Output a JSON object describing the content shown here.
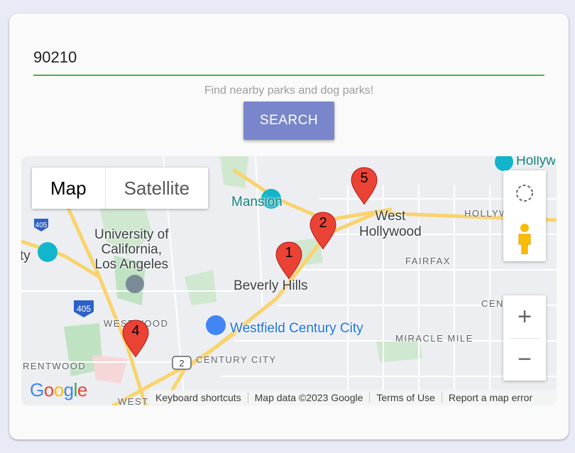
{
  "search": {
    "value": "90210",
    "hint": "Find nearby parks and dog parks!",
    "button_label": "SEARCH"
  },
  "map": {
    "type_buttons": {
      "map": "Map",
      "satellite": "Satellite"
    },
    "labels": {
      "ucla": "University of\nCalifornia,\nLos Angeles",
      "mansion": "Mansion",
      "beverly_hills": "Beverly Hills",
      "west_hollywood": "West\nHollywood",
      "hollywood": "HOLLYWOOD",
      "fairfax": "FAIRFAX",
      "miracle_mile": "MIRACLE MILE",
      "century_city": "CENTURY CITY",
      "westfield": "Westfield Century City",
      "westwood": "WESTWOOD",
      "brentwood": "RENTWOOD",
      "west_bottom": "WEST",
      "cen": "CEN",
      "hollyw": "Hollyw",
      "ty": "ty",
      "hwy_405_top": "405",
      "hwy_405": "405",
      "hwy_2": "2"
    },
    "markers": [
      {
        "number": "1"
      },
      {
        "number": "2"
      },
      {
        "number": "4"
      },
      {
        "number": "5"
      }
    ],
    "footer": {
      "keyboard": "Keyboard shortcuts",
      "data": "Map data ©2023 Google",
      "terms": "Terms of Use",
      "report": "Report a map error"
    },
    "logo": "Google",
    "zoom": {
      "in": "+",
      "out": "−"
    }
  },
  "colors": {
    "accent_green": "#4caf50",
    "button": "#7986cb",
    "marker": "#ea4335",
    "road": "#f9d36b",
    "park": "#c8e6c9"
  }
}
